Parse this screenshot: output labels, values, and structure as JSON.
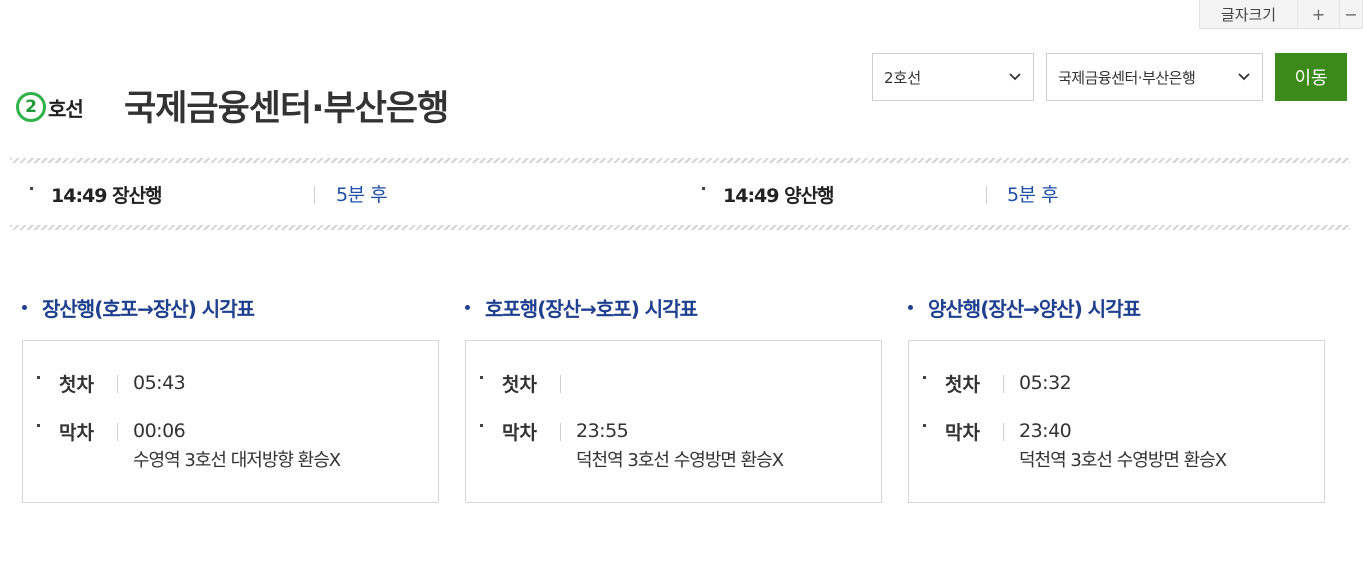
{
  "font_size_control": {
    "label": "글자크기",
    "increase": "+",
    "decrease": "−"
  },
  "header": {
    "line_number": "2",
    "line_suffix": "호선",
    "station_name": "국제금융센터·부산은행",
    "line_color": "#2fb24a"
  },
  "selectors": {
    "line_select": {
      "value": "2호선"
    },
    "station_select": {
      "value": "국제금융센터·부산은행"
    },
    "go_button": "이동",
    "go_button_color": "#3c8a1a"
  },
  "arrivals": [
    {
      "destination": "14:49 장산행",
      "eta": "5분 후"
    },
    {
      "destination": "14:49 양산행",
      "eta": "5분 후"
    }
  ],
  "timetables": [
    {
      "title": "장산행(호포→장산) 시각표",
      "first_label": "첫차",
      "first_time": "05:43",
      "last_label": "막차",
      "last_time": "00:06",
      "last_note": "수영역 3호선 대저방향 환승X"
    },
    {
      "title": "호포행(장산→호포) 시각표",
      "first_label": "첫차",
      "first_time": "",
      "last_label": "막차",
      "last_time": "23:55",
      "last_note": "덕천역 3호선 수영방면 환승X"
    },
    {
      "title": "양산행(장산→양산) 시각표",
      "first_label": "첫차",
      "first_time": "05:32",
      "last_label": "막차",
      "last_time": "23:40",
      "last_note": "덕천역 3호선 수영방면 환승X"
    }
  ],
  "colors": {
    "title_blue": "#1f3f8f",
    "eta_blue": "#1f4fa6"
  }
}
